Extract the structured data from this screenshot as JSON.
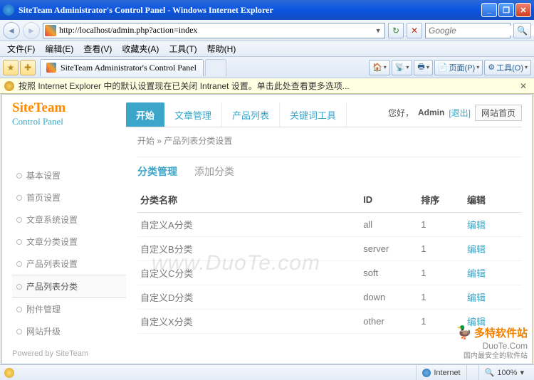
{
  "window": {
    "title": "SiteTeam Administrator's Control Panel - Windows Internet Explorer"
  },
  "address": {
    "url": "http://localhost/admin.php?action=index"
  },
  "search": {
    "placeholder": "Google"
  },
  "menubar": {
    "file": "文件(F)",
    "edit": "编辑(E)",
    "view": "查看(V)",
    "fav": "收藏夹(A)",
    "tools": "工具(T)",
    "help": "帮助(H)"
  },
  "tab": {
    "title": "SiteTeam Administrator's Control Panel"
  },
  "ie_tools": {
    "page": "页面(P)",
    "tools": "工具(O)"
  },
  "infobar": {
    "text": "按照 Internet Explorer 中的默认设置现在已关闭 Intranet 设置。单击此处查看更多选项..."
  },
  "logo": {
    "line1": "SiteTeam",
    "line2": "Control Panel"
  },
  "navtabs": [
    "开始",
    "文章管理",
    "产品列表",
    "关键词工具"
  ],
  "user": {
    "greet": "您好，",
    "name": "Admin",
    "logout": "[退出]",
    "home": "网站首页"
  },
  "breadcrumb": "开始 » 产品列表分类设置",
  "sidebar": [
    "基本设置",
    "首页设置",
    "文章系统设置",
    "文章分类设置",
    "产品列表设置",
    "产品列表分类",
    "附件管理",
    "网站升级"
  ],
  "sidebar_active_index": 5,
  "panel_tabs": {
    "manage": "分类管理",
    "add": "添加分类"
  },
  "table": {
    "headers": {
      "name": "分类名称",
      "id": "ID",
      "sort": "排序",
      "op": "编辑"
    },
    "rows": [
      {
        "name": "自定义A分类",
        "id": "all",
        "sort": "1",
        "op": "编辑"
      },
      {
        "name": "自定义B分类",
        "id": "server",
        "sort": "1",
        "op": "编辑"
      },
      {
        "name": "自定义C分类",
        "id": "soft",
        "sort": "1",
        "op": "编辑"
      },
      {
        "name": "自定义D分类",
        "id": "down",
        "sort": "1",
        "op": "编辑"
      },
      {
        "name": "自定义X分类",
        "id": "other",
        "sort": "1",
        "op": "编辑"
      }
    ]
  },
  "watermark": "www.DuoTe.com",
  "powered": "Powered by SiteTeam",
  "duote": {
    "big": "多特软件站",
    "url": "DuoTe.Com",
    "sub": "国内最安全的软件站"
  },
  "status": {
    "zone": "Internet",
    "zoom": "100%"
  }
}
